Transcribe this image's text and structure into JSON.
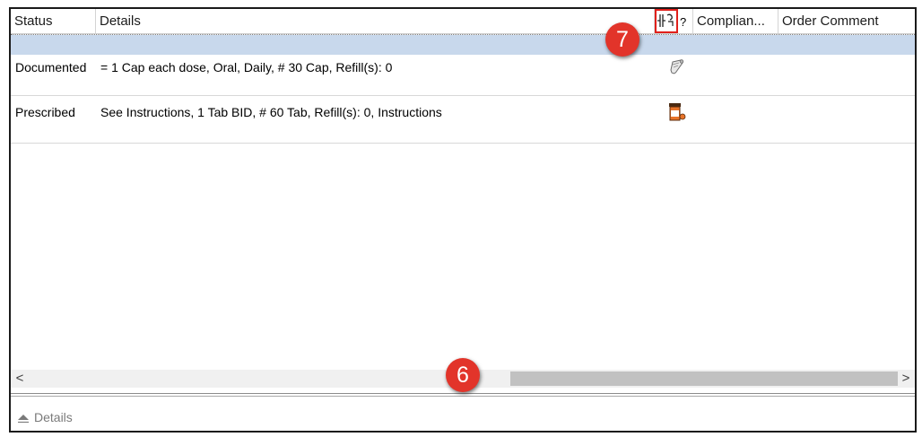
{
  "columns": {
    "status": "Status",
    "details": "Details",
    "help_mark": "?",
    "compliance": "Complian...",
    "order_comment": "Order Comment"
  },
  "header_icon": "column-config-icon",
  "rows": [
    {
      "status": "Documented",
      "details": "= 1 Cap each dose, Oral, Daily, # 30 Cap, Refill(s): 0",
      "icon": "scroll-document-icon"
    },
    {
      "status": "Prescribed",
      "details": "See Instructions, 1 Tab BID, # 60 Tab, Refill(s): 0, Instructions",
      "icon": "prescription-bottle-icon"
    }
  ],
  "scrollbar": {
    "left_arrow": "<",
    "right_arrow": ">"
  },
  "details_panel": {
    "label": "Details"
  },
  "annotations": [
    {
      "label": "7"
    },
    {
      "label": "6"
    }
  ],
  "colors": {
    "selection_row": "#c8d8ec",
    "annotation_badge": "#e2342a",
    "highlight_box": "#e0201b",
    "scroll_thumb": "#c1c1c1"
  }
}
